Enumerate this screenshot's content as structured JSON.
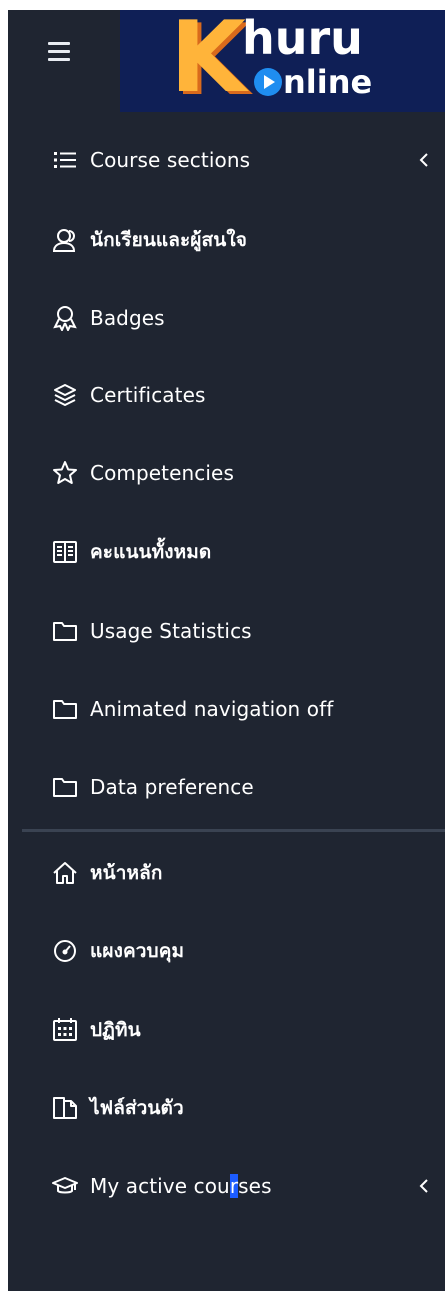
{
  "logo": {
    "letter_k": "K",
    "text_top": "huru",
    "text_bottom": "nline"
  },
  "nav": {
    "items": [
      {
        "label": "Course sections",
        "icon": "list-icon",
        "chevron": true
      },
      {
        "label": "นักเรียนและผู้สนใจ",
        "icon": "users-icon"
      },
      {
        "label": "Badges",
        "icon": "badge-icon"
      },
      {
        "label": "Certificates",
        "icon": "layers-icon"
      },
      {
        "label": "Competencies",
        "icon": "star-icon"
      },
      {
        "label": "คะแนนทั้งหมด",
        "icon": "gradebook-icon"
      },
      {
        "label": "Usage Statistics",
        "icon": "folder-icon"
      },
      {
        "label": "Animated navigation off",
        "icon": "folder-icon"
      },
      {
        "label": "Data preference",
        "icon": "folder-icon"
      }
    ],
    "site_items": [
      {
        "label": "หน้าหลัก",
        "icon": "home-icon"
      },
      {
        "label": "แผงควบคุม",
        "icon": "dashboard-icon"
      },
      {
        "label": "ปฏิทิน",
        "icon": "calendar-icon"
      },
      {
        "label": "ไฟล์ส่วนตัว",
        "icon": "files-icon"
      },
      {
        "label_before": "My active cou",
        "label_highlight": "r",
        "label_after": "ses",
        "icon": "graduation-cap-icon",
        "chevron": true
      }
    ]
  },
  "colors": {
    "sidebar_bg": "#1f2531",
    "logo_bg": "#0f1f56",
    "text": "#ffffff",
    "divider": "#3a4352"
  }
}
